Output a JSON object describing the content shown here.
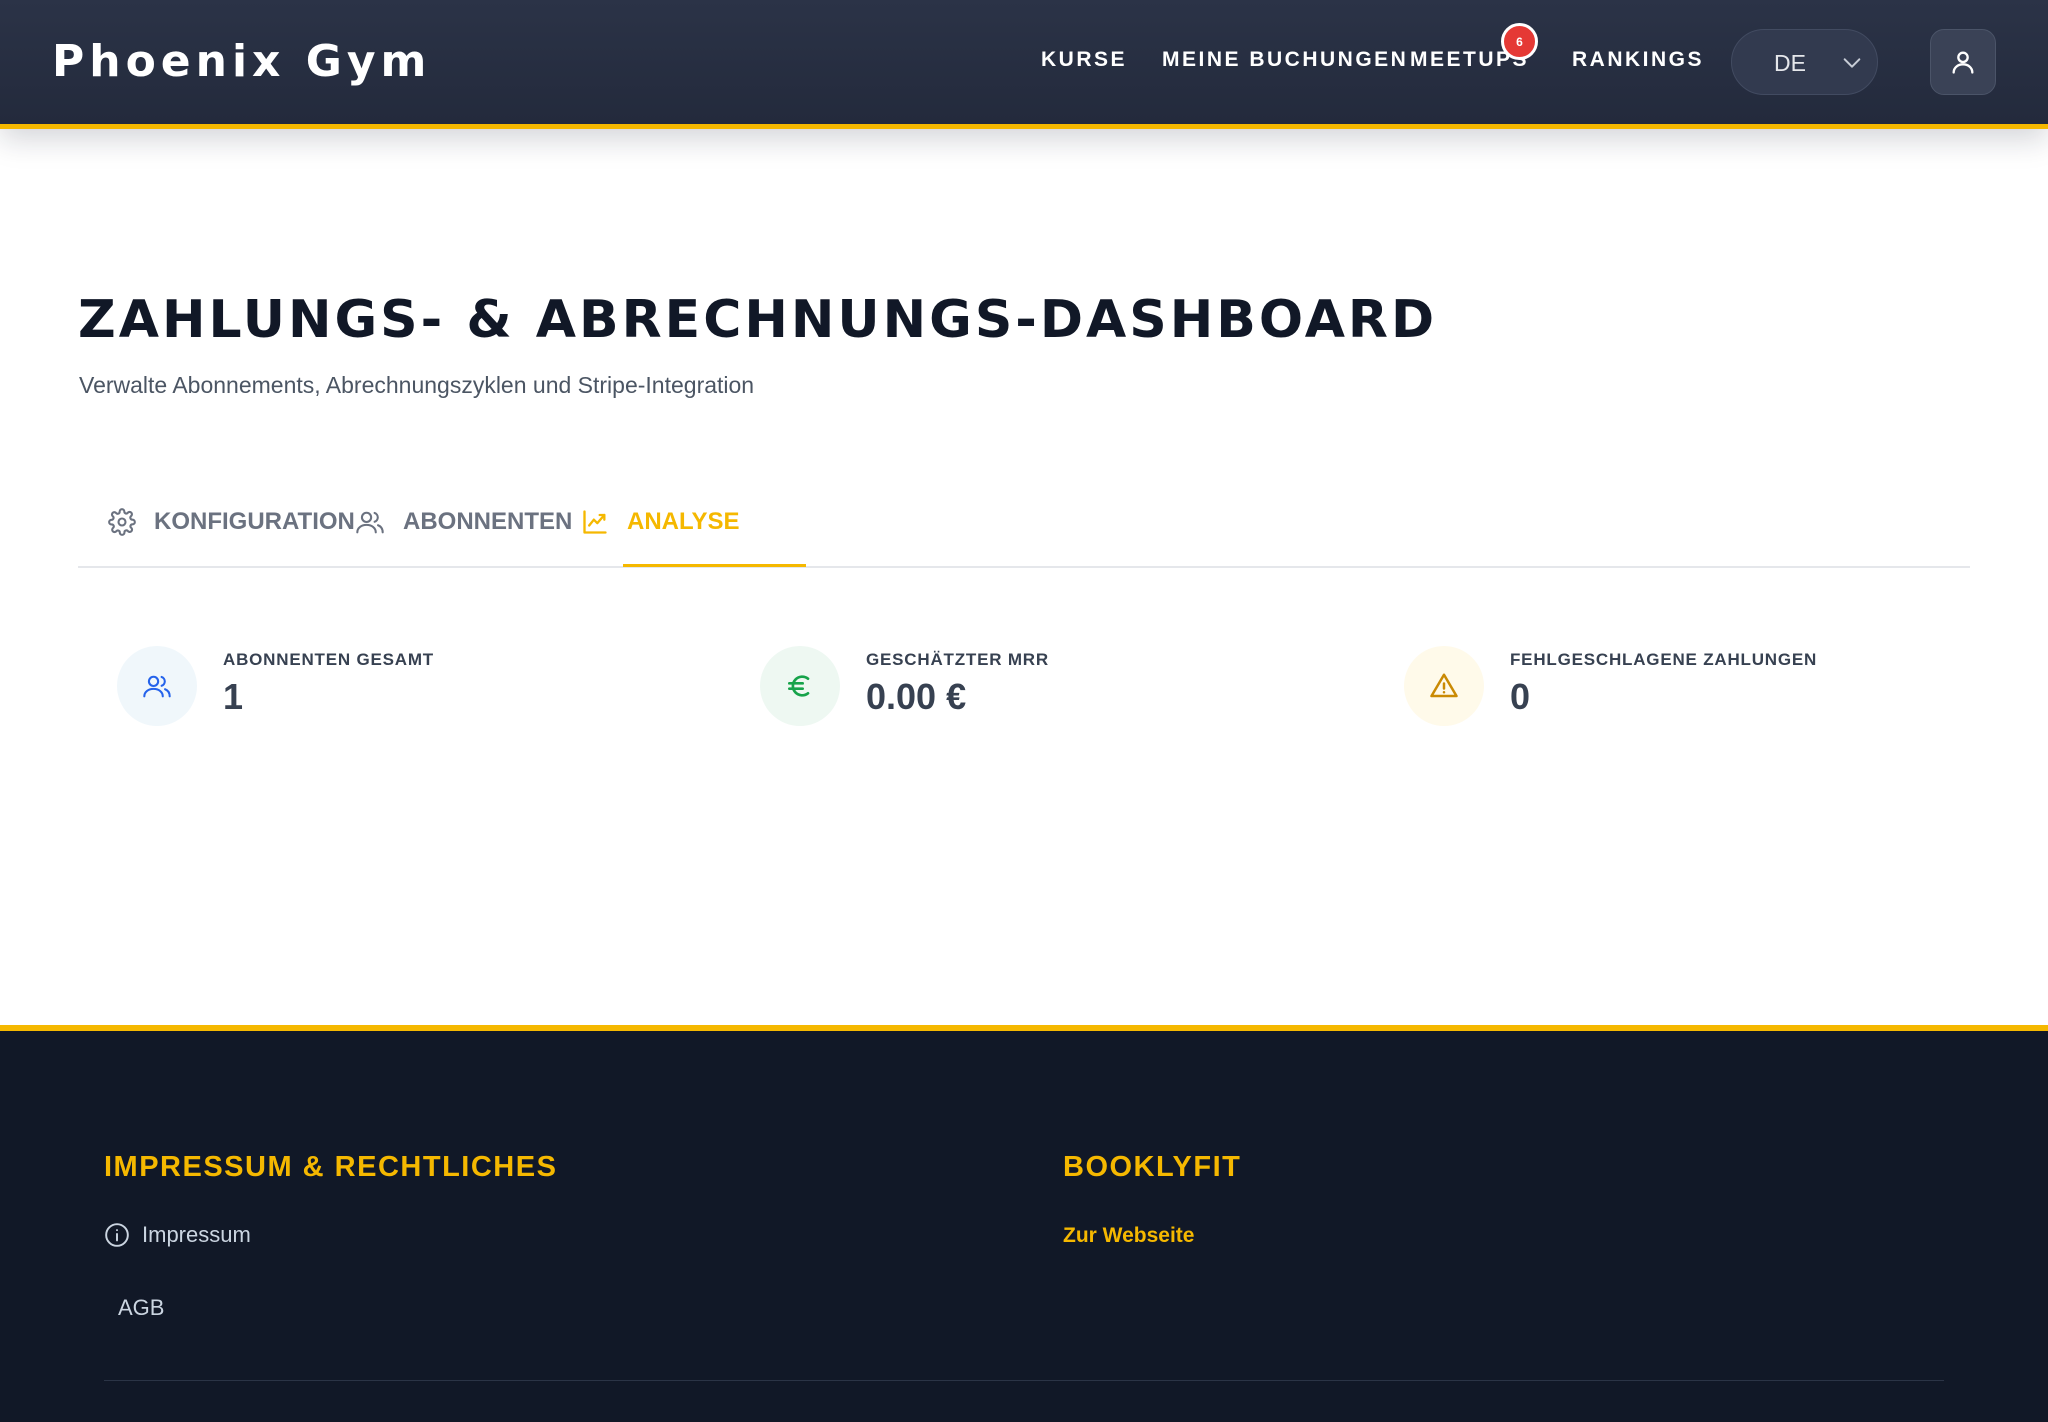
{
  "brand": {
    "name": "Phoenix Gym"
  },
  "nav": {
    "items": [
      {
        "label": "KURSE"
      },
      {
        "label": "MEINE BUCHUNGEN"
      },
      {
        "label": "MEETUPS",
        "badge": "6"
      },
      {
        "label": "RANKINGS"
      }
    ],
    "language": {
      "value": "DE",
      "icon": "chevron-down-icon"
    },
    "user_icon": "user-icon"
  },
  "page": {
    "title": "ZAHLUNGS- & ABRECHNUNGS-DASHBOARD",
    "subtitle": "Verwalte Abonnements, Abrechnungszyklen und Stripe-Integration"
  },
  "tabs": [
    {
      "label": "KONFIGURATION",
      "icon": "gear-icon",
      "active": false
    },
    {
      "label": "ABONNENTEN",
      "icon": "users-icon",
      "active": false
    },
    {
      "label": "ANALYSE",
      "icon": "trending-up-icon",
      "active": true
    }
  ],
  "stats": [
    {
      "label": "ABONNENTEN GESAMT",
      "value": "1",
      "icon": "users-icon",
      "color": "#2563eb"
    },
    {
      "label": "GESCHÄTZTER MRR",
      "value": "0.00 €",
      "icon": "euro-icon",
      "color": "#16a34a"
    },
    {
      "label": "FEHLGESCHLAGENE ZAHLUNGEN",
      "value": "0",
      "icon": "warning-icon",
      "color": "#ca8a04"
    }
  ],
  "footer": {
    "left": {
      "heading": "IMPRESSUM & RECHTLICHES",
      "links": [
        {
          "label": "Impressum",
          "icon": "info-icon"
        },
        {
          "label": "AGB"
        }
      ]
    },
    "right": {
      "heading": "BOOKLYFIT",
      "link": "Zur Webseite"
    }
  },
  "colors": {
    "accent": "#f5b800",
    "header_bg": "#262d40",
    "footer_bg": "#111827",
    "badge": "#e53935"
  }
}
